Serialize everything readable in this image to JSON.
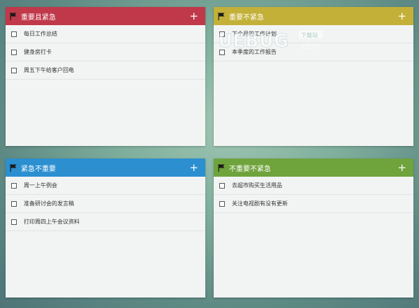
{
  "panels": [
    {
      "title": "重要且紧急",
      "color": "#c0394a",
      "add_label": "+",
      "items": [
        "每日工作总结",
        "健身房打卡",
        "周五下午给客户回电"
      ]
    },
    {
      "title": "重要不紧急",
      "color": "#c3b038",
      "add_label": "+",
      "items": [
        "下个月的工作计划",
        "本季度的工作报告"
      ]
    },
    {
      "title": "紧急不重要",
      "color": "#2b8fd0",
      "add_label": "+",
      "items": [
        "周一上午例会",
        "准备研讨会的发言稿",
        "打印周四上午会议资料"
      ]
    },
    {
      "title": "不重要不紧急",
      "color": "#6fa33c",
      "add_label": "+",
      "items": [
        "去超市购买生活用品",
        "关注电视剧有没有更新"
      ]
    }
  ],
  "watermark": {
    "main": "UEBUG",
    "badge": "下载站",
    "domain": ".com"
  }
}
